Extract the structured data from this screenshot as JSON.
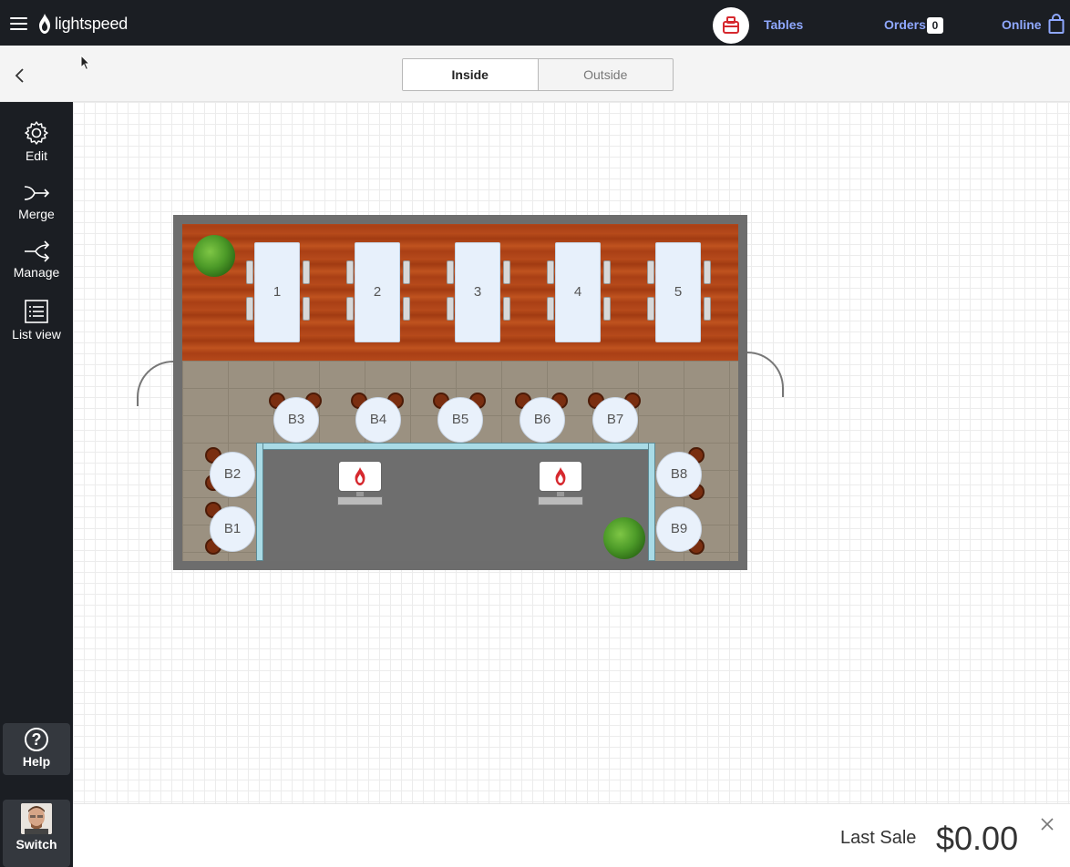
{
  "header": {
    "brand": "lightspeed",
    "nav": {
      "tables": "Tables",
      "orders": "Orders",
      "orders_count": "0",
      "online": "Online"
    }
  },
  "floor_tabs": {
    "inside": "Inside",
    "outside": "Outside",
    "selected": "Inside"
  },
  "sidebar": {
    "items": [
      {
        "label": "Edit",
        "icon": "gear-icon"
      },
      {
        "label": "Merge",
        "icon": "merge-icon"
      },
      {
        "label": "Manage",
        "icon": "split-icon"
      },
      {
        "label": "List view",
        "icon": "list-icon"
      }
    ],
    "help": "Help",
    "switch": "Switch"
  },
  "tables": {
    "long": [
      "1",
      "2",
      "3",
      "4",
      "5"
    ],
    "round": [
      "B1",
      "B2",
      "B3",
      "B4",
      "B5",
      "B6",
      "B7",
      "B8",
      "B9"
    ]
  },
  "footer": {
    "last_sale_label": "Last Sale",
    "last_sale_amount": "$0.00"
  },
  "colors": {
    "topbar": "#1b1e23",
    "accent": "#8fa8ff",
    "brand_red": "#d6282e"
  }
}
